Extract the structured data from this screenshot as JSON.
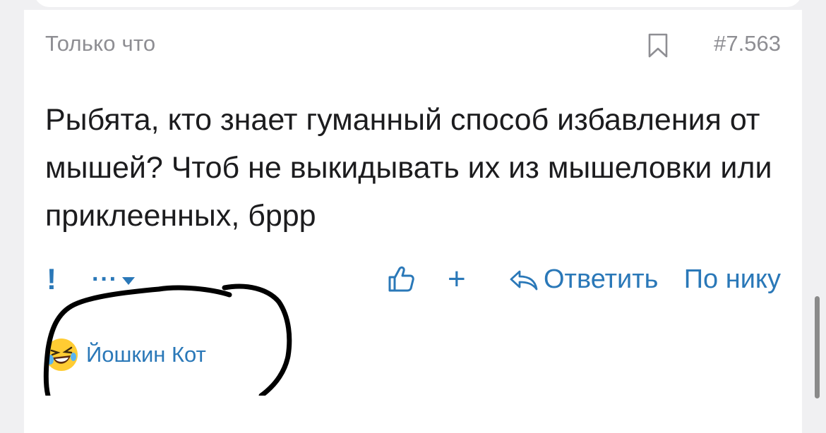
{
  "post": {
    "timestamp": "Только что",
    "number": "#7.563",
    "message": "Рыбята, кто знает гуманный способ избавления от мышей? Чтоб не выкидывать их из мышеловки или приклеенных, бррр"
  },
  "actions": {
    "report": "!",
    "more": "···",
    "plus": "+",
    "reply": "Ответить",
    "by_nick": "По нику"
  },
  "user": {
    "name": "Йошкин Кот"
  },
  "colors": {
    "link": "#2a78b8",
    "muted": "#8e8e93",
    "text": "#1c1c1e"
  },
  "icons": [
    "bookmark-icon",
    "more-icon",
    "thumbs-up-icon",
    "reply-arrow-icon",
    "laughing-emoji-icon"
  ]
}
